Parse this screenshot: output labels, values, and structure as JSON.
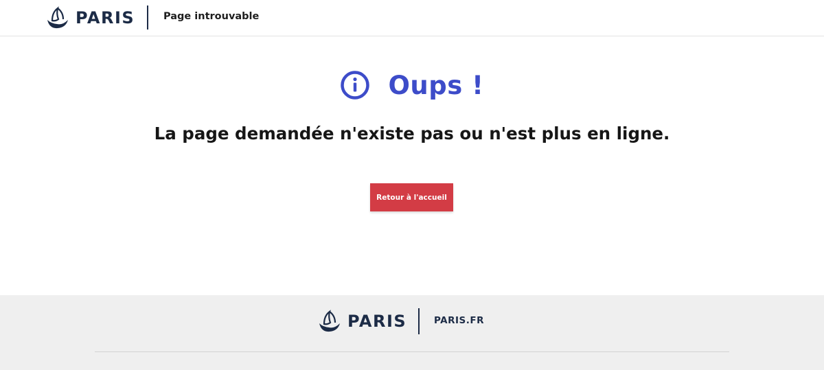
{
  "header": {
    "logo_text": "PARIS",
    "title": "Page introuvable"
  },
  "main": {
    "heading": "Oups !",
    "message": "La page demandée n'existe pas ou n'est plus en ligne.",
    "home_button_label": "Retour à l'accueil"
  },
  "footer": {
    "logo_text": "PARIS",
    "link_label": "PARIS.FR"
  },
  "colors": {
    "brand_navy": "#1c2b46",
    "accent_blue": "#3d4cc9",
    "button_red": "#d33c45",
    "footer_bg": "#efefef"
  },
  "icons": {
    "logo": "paris-boat-logo-icon",
    "info": "info-circle-icon"
  }
}
